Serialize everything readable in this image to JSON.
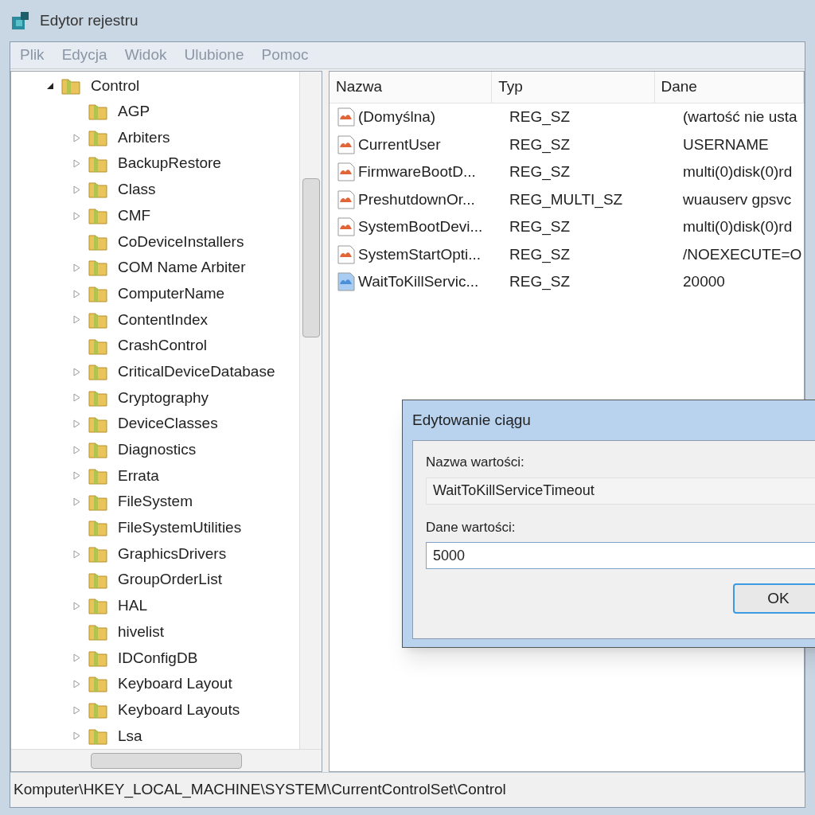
{
  "window": {
    "title": "Edytor rejestru"
  },
  "menu": [
    "Plik",
    "Edycja",
    "Widok",
    "Ulubione",
    "Pomoc"
  ],
  "tree": {
    "label": "Control",
    "expanded": true,
    "children": [
      {
        "label": "AGP",
        "expandable": false
      },
      {
        "label": "Arbiters",
        "expandable": true
      },
      {
        "label": "BackupRestore",
        "expandable": true
      },
      {
        "label": "Class",
        "expandable": true
      },
      {
        "label": "CMF",
        "expandable": true
      },
      {
        "label": "CoDeviceInstallers",
        "expandable": false
      },
      {
        "label": "COM Name Arbiter",
        "expandable": true
      },
      {
        "label": "ComputerName",
        "expandable": true
      },
      {
        "label": "ContentIndex",
        "expandable": true
      },
      {
        "label": "CrashControl",
        "expandable": false
      },
      {
        "label": "CriticalDeviceDatabase",
        "expandable": true
      },
      {
        "label": "Cryptography",
        "expandable": true
      },
      {
        "label": "DeviceClasses",
        "expandable": true
      },
      {
        "label": "Diagnostics",
        "expandable": true
      },
      {
        "label": "Errata",
        "expandable": true
      },
      {
        "label": "FileSystem",
        "expandable": true
      },
      {
        "label": "FileSystemUtilities",
        "expandable": false
      },
      {
        "label": "GraphicsDrivers",
        "expandable": true
      },
      {
        "label": "GroupOrderList",
        "expandable": false
      },
      {
        "label": "HAL",
        "expandable": true
      },
      {
        "label": "hivelist",
        "expandable": false
      },
      {
        "label": "IDConfigDB",
        "expandable": true
      },
      {
        "label": "Keyboard Layout",
        "expandable": true
      },
      {
        "label": "Keyboard Layouts",
        "expandable": true
      },
      {
        "label": "Lsa",
        "expandable": true
      }
    ]
  },
  "values": {
    "columns": [
      "Nazwa",
      "Typ",
      "Dane"
    ],
    "rows": [
      {
        "kind": "string",
        "name": "(Domyślna)",
        "type": "REG_SZ",
        "data": "(wartość nie usta"
      },
      {
        "kind": "string",
        "name": "CurrentUser",
        "type": "REG_SZ",
        "data": "USERNAME"
      },
      {
        "kind": "string",
        "name": "FirmwareBootD...",
        "type": "REG_SZ",
        "data": "multi(0)disk(0)rd"
      },
      {
        "kind": "string",
        "name": "PreshutdownOr...",
        "type": "REG_MULTI_SZ",
        "data": "wuauserv gpsvc"
      },
      {
        "kind": "string",
        "name": "SystemBootDevi...",
        "type": "REG_SZ",
        "data": "multi(0)disk(0)rd"
      },
      {
        "kind": "string",
        "name": "SystemStartOpti...",
        "type": "REG_SZ",
        "data": "/NOEXECUTE=O"
      },
      {
        "kind": "binary",
        "name": "WaitToKillServic...",
        "type": "REG_SZ",
        "data": "20000"
      }
    ]
  },
  "dialog": {
    "title": "Edytowanie ciągu",
    "name_label": "Nazwa wartości:",
    "name_value": "WaitToKillServiceTimeout",
    "data_label": "Dane wartości:",
    "data_value": "5000",
    "ok_button": "OK"
  },
  "status_bar": "Komputer\\HKEY_LOCAL_MACHINE\\SYSTEM\\CurrentControlSet\\Control"
}
